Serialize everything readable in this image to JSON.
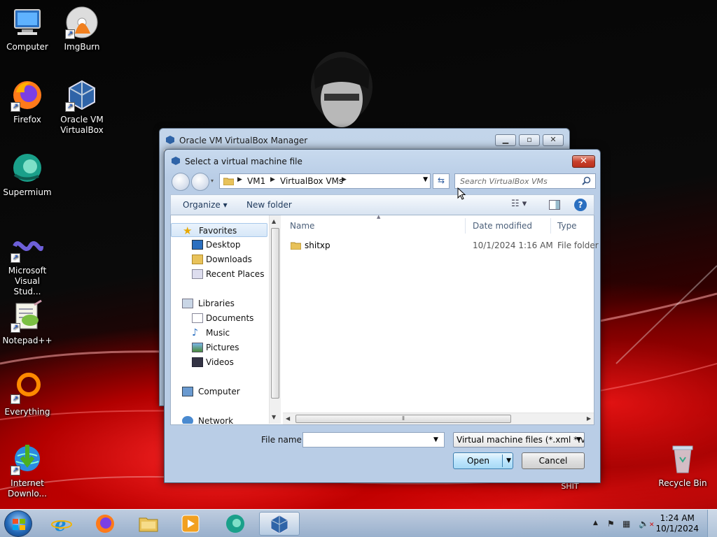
{
  "desktop": {
    "icons": [
      {
        "label": "Computer"
      },
      {
        "label": "ImgBurn"
      },
      {
        "label": "Firefox"
      },
      {
        "label": "Oracle VM VirtualBox"
      },
      {
        "label": "Supermium"
      },
      {
        "label": "Microsoft Visual Stud..."
      },
      {
        "label": "Notepad++"
      },
      {
        "label": "Everything"
      },
      {
        "label": "Internet Downlo..."
      },
      {
        "label": "Recycle Bin"
      }
    ],
    "caption_behind": "SHIT"
  },
  "bg_window": {
    "title": "Oracle VM VirtualBox Manager"
  },
  "dialog": {
    "title": "Select a virtual machine file",
    "breadcrumbs": [
      "VM1",
      "VirtualBox VMs"
    ],
    "search_placeholder": "Search VirtualBox VMs",
    "toolbar": {
      "organize": "Organize",
      "new_folder": "New folder"
    },
    "nav": {
      "favorites": "Favorites",
      "desktop": "Desktop",
      "downloads": "Downloads",
      "recent_places": "Recent Places",
      "libraries": "Libraries",
      "documents": "Documents",
      "music": "Music",
      "pictures": "Pictures",
      "videos": "Videos",
      "computer": "Computer",
      "network": "Network"
    },
    "columns": {
      "name": "Name",
      "date_modified": "Date modified",
      "type": "Type"
    },
    "files": [
      {
        "name": "shitxp",
        "date": "10/1/2024 1:16 AM",
        "type": "File folder"
      }
    ],
    "file_name_label": "File name:",
    "file_name_value": "",
    "filter": "Virtual machine files (*.xml *.vb",
    "open_label": "Open",
    "cancel_label": "Cancel"
  },
  "taskbar": {
    "time": "1:24 AM",
    "date": "10/1/2024"
  },
  "colors": {
    "accent": "#3c7fb1",
    "close_red": "#c8402c",
    "taskbar": "#a9c7e2"
  }
}
